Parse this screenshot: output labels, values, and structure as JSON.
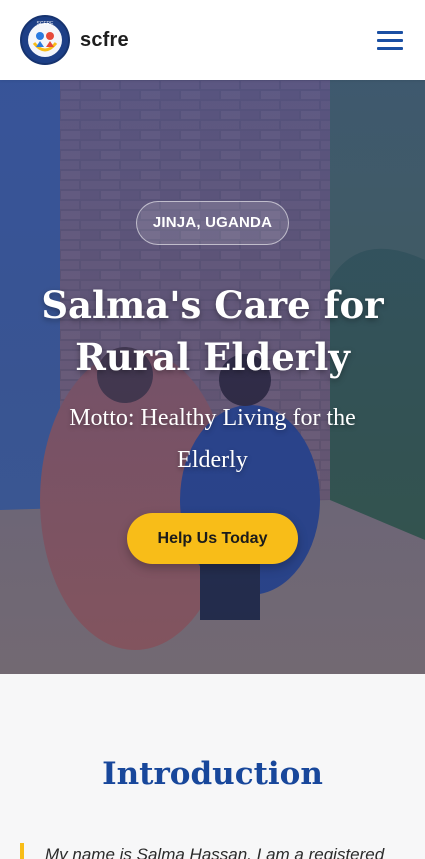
{
  "header": {
    "brand": "scfre",
    "logo_text": "SCFRE",
    "logo_ring_text": "SALMA'S CARE FOR RURAL ELDERLY",
    "menu_icon": "hamburger-menu-icon"
  },
  "hero": {
    "location": "JINJA, UGANDA",
    "title": "Salma's Care for Rural Elderly",
    "motto": "Motto: Healthy Living for the Elderly",
    "cta_label": "Help Us Today"
  },
  "intro": {
    "title": "Introduction",
    "text": "My name is Salma Hassan. I am a registered"
  },
  "colors": {
    "primary_blue": "#18479b",
    "accent_yellow": "#f8bd18",
    "header_bg": "#ffffff",
    "page_bg": "#f7f7f8"
  }
}
